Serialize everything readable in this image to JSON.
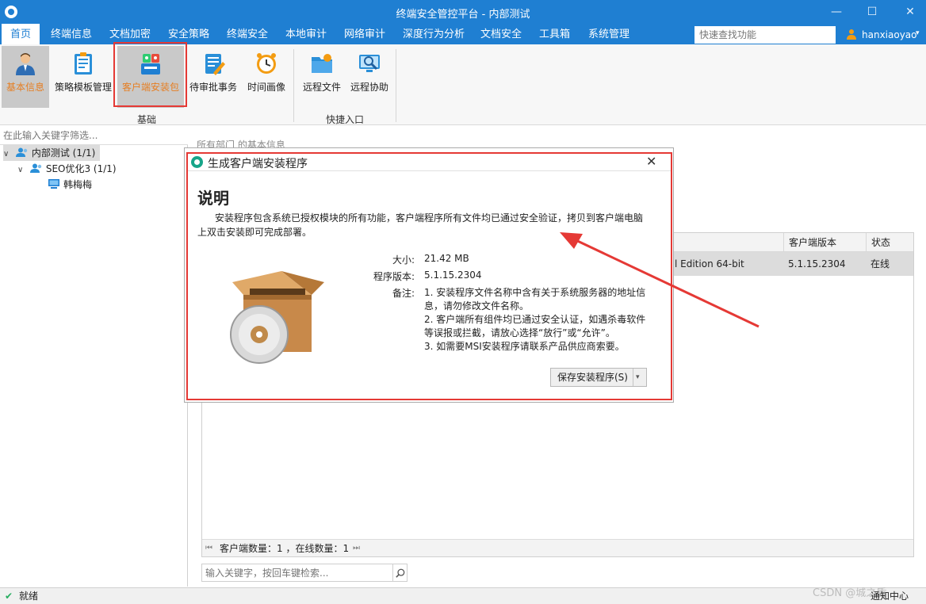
{
  "window": {
    "title": "终端安全管控平台 - 内部测试",
    "min_glyph": "—",
    "max_glyph": "☐",
    "close_glyph": "✕"
  },
  "menu": {
    "items": [
      "首页",
      "终端信息",
      "文档加密",
      "安全策略",
      "终端安全",
      "本地审计",
      "网络审计",
      "深度行为分析",
      "文档安全",
      "工具箱",
      "系统管理"
    ],
    "active_index": 0,
    "quick_search_placeholder": "快速查找功能",
    "username": "hanxiaoyao",
    "caret": "▾"
  },
  "ribbon": {
    "buttons": [
      {
        "label": "基本信息",
        "icon": "user-info-icon"
      },
      {
        "label": "策略模板管理",
        "icon": "policy-template-icon"
      },
      {
        "label": "客户端安装包",
        "icon": "client-package-icon"
      },
      {
        "label": "待审批事务",
        "icon": "approval-icon"
      },
      {
        "label": "时间画像",
        "icon": "alarm-clock-icon"
      },
      {
        "label": "远程文件",
        "icon": "remote-file-icon"
      },
      {
        "label": "远程协助",
        "icon": "remote-assist-icon"
      }
    ],
    "groups": [
      "基础",
      "快捷入口"
    ]
  },
  "tree": {
    "filter_placeholder": "在此输入关键字筛选...",
    "nodes": [
      {
        "label": "内部测试 (1/1)",
        "chevron": "∨"
      },
      {
        "label": "SEO优化3 (1/1)",
        "chevron": "∨"
      },
      {
        "label": "韩梅梅"
      }
    ]
  },
  "main": {
    "breadcrumb": "所有部门 的基本信息",
    "columns": [
      "客户端版本",
      "状态"
    ],
    "row": {
      "os": "l Edition 64-bit",
      "version": "5.1.15.2304",
      "status": "在线"
    },
    "footer": "客户端数量：1 ，在线数量：1",
    "footer_first": "⏮",
    "footer_last": "⏭",
    "search_placeholder": "输入关键字，按回车键检索..."
  },
  "dialog": {
    "title": "生成客户端安装程序",
    "close": "✕",
    "heading": "说明",
    "description": "安装程序包含系统已授权模块的所有功能，客户端程序所有文件均已通过安全验证，拷贝到客户端电脑上双击安装即可完成部署。",
    "size_label": "大小:",
    "size_value": "21.42 MB",
    "version_label": "程序版本:",
    "version_value": "5.1.15.2304",
    "notes_label": "备注:",
    "notes": [
      "1. 安装程序文件名称中含有关于系统服务器的地址信息，请勿修改文件名称。",
      "2. 客户端所有组件均已通过安全认证，如遇杀毒软件等误报或拦截，请放心选择“放行”或“允许”。",
      "3. 如需要MSI安装程序请联系产品供应商索要。"
    ],
    "save_button": "保存安装程序(S)",
    "save_caret": "▾"
  },
  "status": {
    "text": "就绪",
    "check": "✔",
    "notify": "通知中心",
    "watermark": "CSDN @城之盾"
  },
  "colors": {
    "brand": "#1f7fd2",
    "highlight": "#e53935",
    "selected_label": "#e67e22"
  }
}
